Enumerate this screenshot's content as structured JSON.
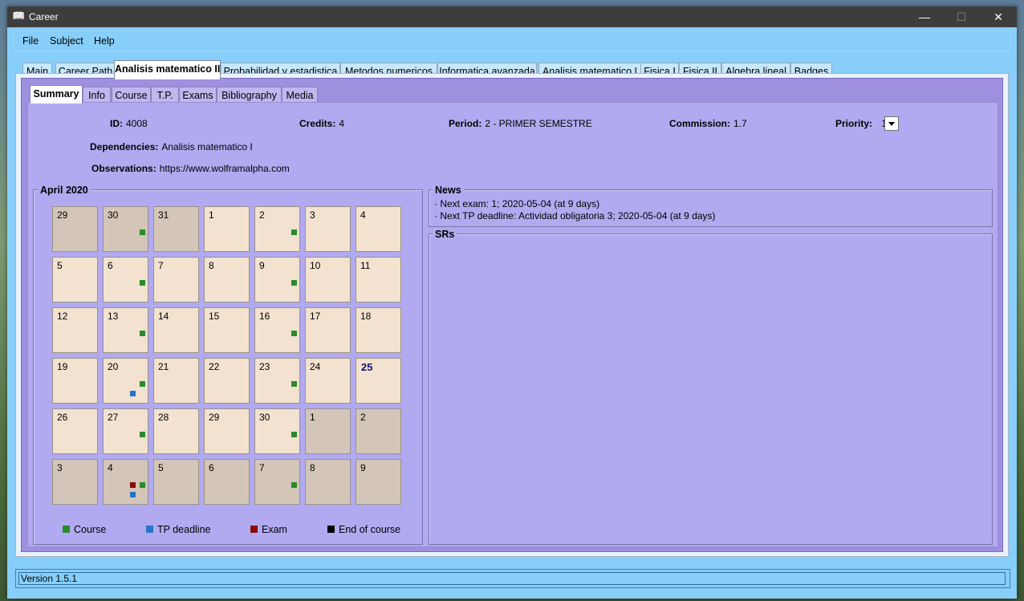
{
  "window": {
    "title": "Career",
    "icon": "book-icon",
    "controls": {
      "minimize": "—",
      "maximize": "☐",
      "close": "✕"
    }
  },
  "menu": {
    "items": [
      "File",
      "Subject",
      "Help"
    ]
  },
  "top_tabs": [
    "Main",
    "Career Path",
    "Analisis matematico II",
    "Probabilidad y estadistica",
    "Metodos numericos",
    "Informatica avanzada",
    "Analisis matematico I",
    "Fisica I",
    "Fisica II",
    "Algebra lineal",
    "Badges"
  ],
  "top_tabs_active": "Analisis matematico II",
  "inner_tabs": [
    "Summary",
    "Info",
    "Course",
    "T.P.",
    "Exams",
    "Bibliography",
    "Media"
  ],
  "inner_tabs_active": "Summary",
  "summary": {
    "id_label": "ID:",
    "id": "4008",
    "credits_label": "Credits:",
    "credits": "4",
    "period_label": "Period:",
    "period": "2 - PRIMER SEMESTRE",
    "commission_label": "Commission:",
    "commission": "1.7",
    "priority_label": "Priority:",
    "priority": "1",
    "dependencies_label": "Dependencies:",
    "dependencies": "Analisis matematico I",
    "observations_label": "Observations:",
    "observations": "https://www.wolframalpha.com"
  },
  "calendar": {
    "title": "April 2020",
    "today": "25",
    "colors": {
      "course": "#2a8a2a",
      "tp_deadline": "#2874c8",
      "exam": "#8b0b0b",
      "end_of_course": "#000000"
    },
    "weeks": [
      [
        {
          "d": "29",
          "other": true
        },
        {
          "d": "30",
          "other": true,
          "m": [
            "course"
          ]
        },
        {
          "d": "31",
          "other": true
        },
        {
          "d": "1"
        },
        {
          "d": "2",
          "m": [
            "course"
          ]
        },
        {
          "d": "3"
        },
        {
          "d": "4"
        }
      ],
      [
        {
          "d": "5"
        },
        {
          "d": "6",
          "m": [
            "course"
          ]
        },
        {
          "d": "7"
        },
        {
          "d": "8"
        },
        {
          "d": "9",
          "m": [
            "course"
          ]
        },
        {
          "d": "10"
        },
        {
          "d": "11"
        }
      ],
      [
        {
          "d": "12"
        },
        {
          "d": "13",
          "m": [
            "course"
          ]
        },
        {
          "d": "14"
        },
        {
          "d": "15"
        },
        {
          "d": "16",
          "m": [
            "course"
          ]
        },
        {
          "d": "17"
        },
        {
          "d": "18"
        }
      ],
      [
        {
          "d": "19"
        },
        {
          "d": "20",
          "m": [
            "course",
            "tp_deadline"
          ]
        },
        {
          "d": "21"
        },
        {
          "d": "22"
        },
        {
          "d": "23",
          "m": [
            "course"
          ]
        },
        {
          "d": "24"
        },
        {
          "d": "25",
          "today": true
        }
      ],
      [
        {
          "d": "26"
        },
        {
          "d": "27",
          "m": [
            "course"
          ]
        },
        {
          "d": "28"
        },
        {
          "d": "29"
        },
        {
          "d": "30",
          "m": [
            "course"
          ]
        },
        {
          "d": "1",
          "other": true
        },
        {
          "d": "2",
          "other": true
        }
      ],
      [
        {
          "d": "3",
          "other": true
        },
        {
          "d": "4",
          "other": true,
          "m": [
            "exam",
            "course",
            "tp_deadline"
          ]
        },
        {
          "d": "5",
          "other": true
        },
        {
          "d": "6",
          "other": true
        },
        {
          "d": "7",
          "other": true,
          "m": [
            "course"
          ]
        },
        {
          "d": "8",
          "other": true
        },
        {
          "d": "9",
          "other": true
        }
      ]
    ],
    "legend": [
      {
        "key": "course",
        "label": "Course"
      },
      {
        "key": "tp_deadline",
        "label": "TP deadline"
      },
      {
        "key": "exam",
        "label": "Exam"
      },
      {
        "key": "end_of_course",
        "label": "End of course"
      }
    ]
  },
  "news": {
    "title": "News",
    "items": [
      "· Next exam: 1; 2020-05-04 (at 9 days)",
      "· Next TP deadline: Actividad obligatoria 3; 2020-05-04 (at 9 days)"
    ]
  },
  "srs": {
    "title": "SRs"
  },
  "status": {
    "version": "Version 1.5.1"
  }
}
